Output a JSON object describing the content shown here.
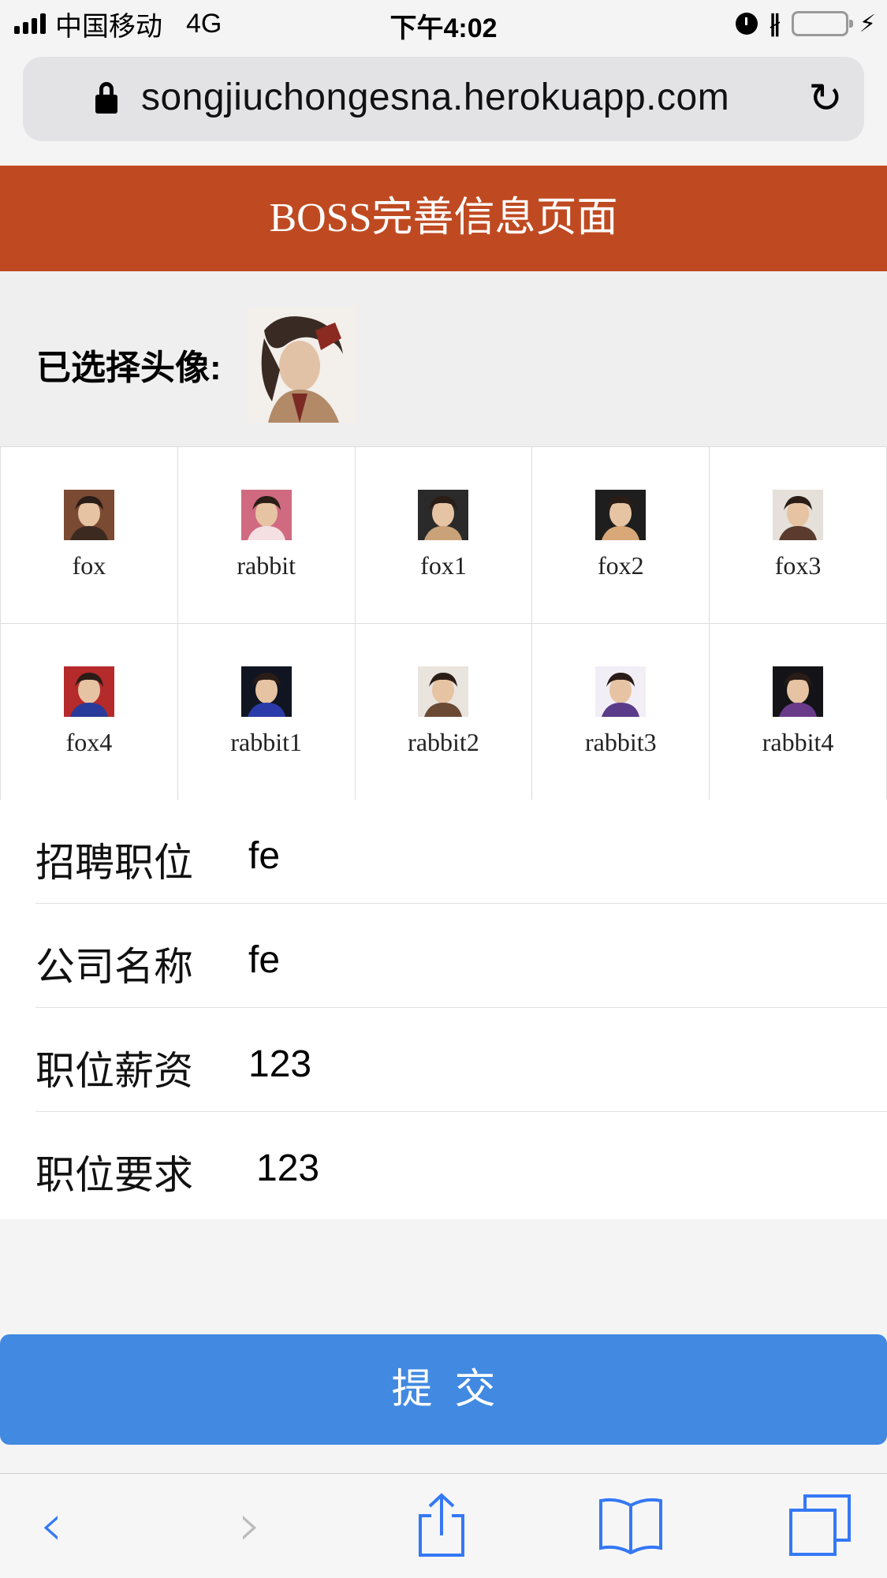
{
  "status_bar": {
    "carrier": "中国移动",
    "network": "4G",
    "time": "下午4:02",
    "battery_color": "#6ed34f"
  },
  "browser": {
    "url": "songjiuchongesna.herokuapp.com"
  },
  "header": {
    "title": "BOSS完善信息页面",
    "background": "#bf4a22"
  },
  "avatar_selector": {
    "selected_label": "已选择头像:",
    "selected_avatar": "fox3",
    "avatars": [
      {
        "name": "fox",
        "colors": [
          "#7a4a32",
          "#3c2a20"
        ]
      },
      {
        "name": "rabbit",
        "colors": [
          "#d06a80",
          "#f4dfe3"
        ]
      },
      {
        "name": "fox1",
        "colors": [
          "#2a2a2a",
          "#c9a27a"
        ]
      },
      {
        "name": "fox2",
        "colors": [
          "#1e1e1e",
          "#d8a878"
        ]
      },
      {
        "name": "fox3",
        "colors": [
          "#e6e0da",
          "#5a3b2e"
        ]
      },
      {
        "name": "fox4",
        "colors": [
          "#b52a2a",
          "#2a3a9a"
        ]
      },
      {
        "name": "rabbit1",
        "colors": [
          "#111522",
          "#2a3aa8"
        ]
      },
      {
        "name": "rabbit2",
        "colors": [
          "#eae4de",
          "#6b4a35"
        ]
      },
      {
        "name": "rabbit3",
        "colors": [
          "#f2eef6",
          "#5a3b8a"
        ]
      },
      {
        "name": "rabbit4",
        "colors": [
          "#141418",
          "#6a3a8a"
        ]
      }
    ]
  },
  "form": {
    "fields": [
      {
        "label": "招聘职位",
        "value": "fe"
      },
      {
        "label": "公司名称",
        "value": "fe"
      },
      {
        "label": "职位薪资",
        "value": "123"
      },
      {
        "label": "职位要求",
        "value": "123"
      }
    ]
  },
  "submit": {
    "label": "提交",
    "color": "#4189e1"
  },
  "toolbar": {
    "accent": "#3478f6",
    "icons": [
      "back-icon",
      "forward-icon",
      "share-icon",
      "bookmarks-icon",
      "tabs-icon"
    ]
  }
}
